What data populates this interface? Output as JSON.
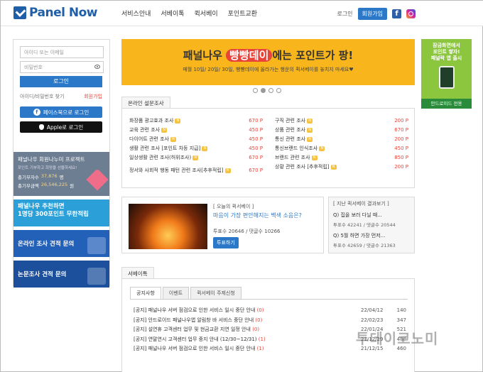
{
  "header": {
    "logo": "Panel Now",
    "nav": [
      "서비스안내",
      "서베이톡",
      "퀵서베이",
      "포인트교환"
    ],
    "login": "로그인",
    "join": "회원가입"
  },
  "login": {
    "id_placeholder": "아이디 또는 이메일",
    "pw_placeholder": "비밀번호",
    "login_btn": "로그인",
    "find": "아이디/비밀번호 찾기",
    "join": "회원가입",
    "facebook": "페이스북으로 로그인",
    "apple": "Apple로 로그인"
  },
  "promos": {
    "p1_title": "패널나우 회원나누미 프로젝트",
    "p1_sub": "포인트 기부하고 희망을 선물하세요!",
    "p1_k1": "총기부자수",
    "p1_v1": "37,876",
    "p1_u1": "명",
    "p1_k2": "총기부금액",
    "p1_v2": "26,546,225",
    "p1_u2": "원",
    "p2_line1": "패널나우 추천하면",
    "p2_line2": "1명당 300포인트 무한적립",
    "p3": "온라인 조사 견적 문의",
    "p4": "논문조사 견적 문의"
  },
  "banner": {
    "pre": "패널나우 ",
    "pill": "빵빵데이",
    "post": "에는 포인트가 팡!",
    "sub": "매월 10일/ 20일/ 30일, 빵빵데이에 올라가는 행운의 퀵서베이를 놓치지 마세요♥"
  },
  "right_banner": {
    "line1": "잠금화면에서",
    "line2": "포인트 쌓자!",
    "line3": "패널락 앱 출시",
    "bottom": "안드로이드 전용"
  },
  "survey": {
    "tab": "온라인 설문조사",
    "left": [
      {
        "name": "화장품 광고효과 조사",
        "points": "670 P"
      },
      {
        "name": "교육 관련 조사",
        "points": "450 P"
      },
      {
        "name": "다이어트 관련 조사",
        "points": "450 P"
      },
      {
        "name": "생활 관련 조사 [포인트 차등 지급]",
        "points": "450 P"
      },
      {
        "name": "일상생활 관련 조사(허위조사)",
        "points": "670 P"
      },
      {
        "name": "정서와 사회적 행동 패턴 관련 조사[추후적립]",
        "points": "670 P"
      }
    ],
    "right": [
      {
        "name": "구직 관련 조사",
        "points": "200 P"
      },
      {
        "name": "상품 관련 조사",
        "points": "670 P"
      },
      {
        "name": "통신 관련 조사",
        "points": "200 P"
      },
      {
        "name": "통신브랜드 인식조사",
        "points": "450 P"
      },
      {
        "name": "브랜드 관련 조사",
        "points": "850 P"
      },
      {
        "name": "상황 관련 조사 [추후적립]",
        "points": "200 P"
      }
    ]
  },
  "today": {
    "caption": "[ 오늘의 퀵서베이 ]",
    "question": "마음이 가장 편안해지는 백색 소음은?",
    "votes_label": "투표수",
    "votes": "20646",
    "comments_label": "댓글수",
    "comments": "10266",
    "vote_btn": "투표하기"
  },
  "past": {
    "caption": "[ 지난 퀵서베이 결과보기 ]",
    "items": [
      {
        "q": "Q) 집을 보러 다닐 때...",
        "votes_label": "투표수",
        "votes": "42241",
        "comments_label": "댓글수",
        "comments": "20544"
      },
      {
        "q": "Q) 5월 하면 가장 먼저...",
        "votes_label": "투표수",
        "votes": "42659",
        "comments_label": "댓글수",
        "comments": "21363"
      }
    ]
  },
  "notice": {
    "tab": "서베이톡",
    "tabs": [
      "공지사항",
      "이벤트",
      "퀵서베이 주제신청"
    ],
    "rows": [
      {
        "title": "[공지] 패널나우 서버 점검으로 인한 서비스 일시 중단 안내",
        "count": "(0)",
        "date": "22/04/12",
        "views": "140"
      },
      {
        "title": "[공지] 안드로이드 패널나우앱 알림창 바 서비스 중단 안내",
        "count": "(0)",
        "date": "22/02/23",
        "views": "347"
      },
      {
        "title": "[공지] 설연휴 고객센터 업무 및 현금교환 지연 일정 안내",
        "count": "(0)",
        "date": "22/01/24",
        "views": "521"
      },
      {
        "title": "[공지] 연말연시 고객센터 업무 중지 안내 (12/30~12/31)",
        "count": "(1)",
        "date": "21/12/29",
        "views": "488"
      },
      {
        "title": "[공지] 패널나우 서버 점검으로 인한 서비스 일시 중단 안내",
        "count": "(1)",
        "date": "21/12/15",
        "views": "460"
      }
    ]
  },
  "watermark": "투데이코노미",
  "colors": {
    "accent": "#2b78c8",
    "banner": "#f9b61c",
    "points": "#e8443a"
  }
}
